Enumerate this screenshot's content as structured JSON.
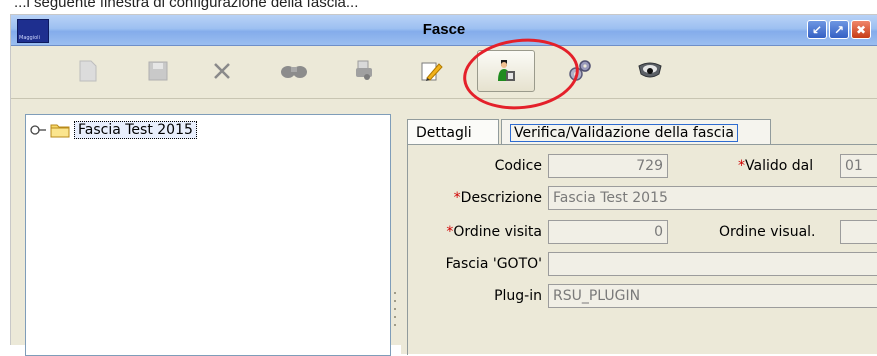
{
  "window": {
    "title": "Fasce",
    "app_logo_text": "Maggioli"
  },
  "caption": {
    "text": "...i seguente finestra di configurazione della fascia..."
  },
  "toolbar": {
    "items": [
      {
        "name": "new-document-icon",
        "active": false
      },
      {
        "name": "save-icon",
        "active": false
      },
      {
        "name": "delete-icon",
        "active": false
      },
      {
        "name": "binoculars-icon",
        "active": false
      },
      {
        "name": "print-icon",
        "active": false
      },
      {
        "name": "edit-icon",
        "active": true
      },
      {
        "name": "validate-icon",
        "active": true
      },
      {
        "name": "gears-icon",
        "active": false
      },
      {
        "name": "camera-icon",
        "active": false
      }
    ]
  },
  "tree": {
    "items": [
      {
        "label": "Fascia Test 2015"
      }
    ]
  },
  "tabs": [
    {
      "label": "Dettagli",
      "selected": true
    },
    {
      "label": "Verifica/Validazione della fascia",
      "selected": false
    }
  ],
  "form": {
    "codice": {
      "label": "Codice",
      "value": "729"
    },
    "valido_dal": {
      "required_mark": "*",
      "label": "Valido dal",
      "value": "01"
    },
    "descrizione": {
      "required_mark": "*",
      "label": "Descrizione",
      "value": "Fascia Test 2015"
    },
    "ordine_visita": {
      "required_mark": "*",
      "label": "Ordine visita",
      "value": "0"
    },
    "ordine_visual": {
      "label": "Ordine visual.",
      "value": ""
    },
    "fascia_goto": {
      "label": "Fascia 'GOTO'",
      "value": ""
    },
    "plugin": {
      "label": "Plug-in",
      "value": "RSU_PLUGIN"
    }
  }
}
